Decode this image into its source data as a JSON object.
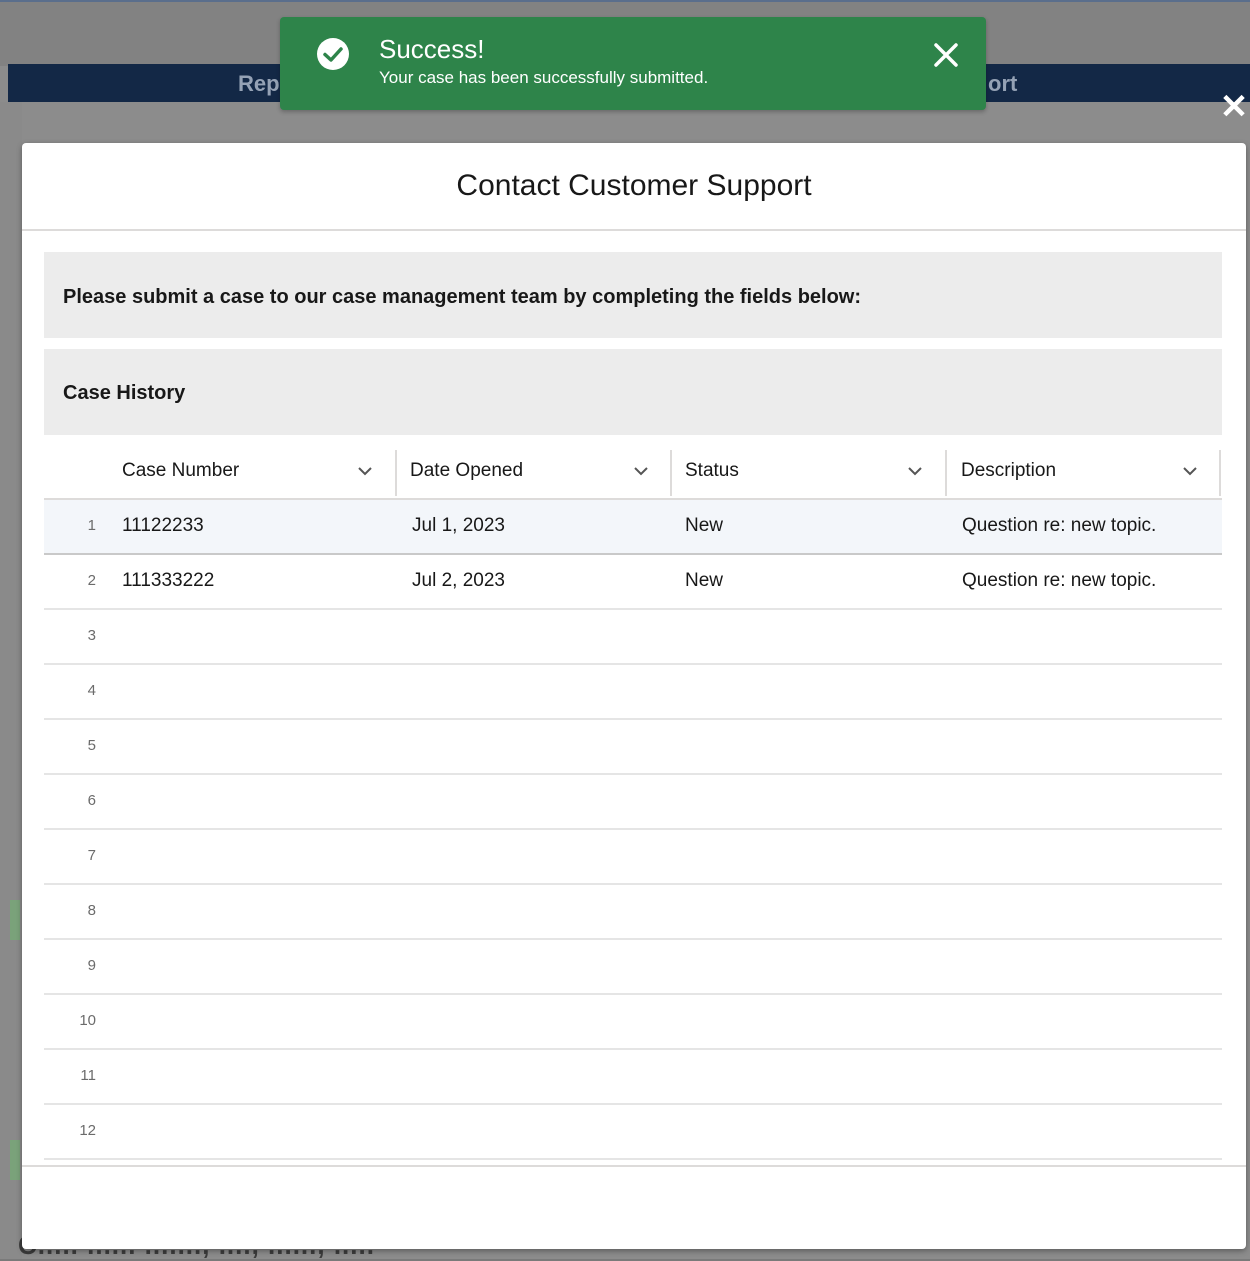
{
  "background": {
    "navbar_left_fragment": "Rep",
    "navbar_right_fragment": "ort",
    "footer_fragment": "C..... ...... ......., ...., ......, ....."
  },
  "toast": {
    "title": "Success!",
    "message": "Your case has been successfully submitted.",
    "icon": "success-check-icon",
    "close_icon": "close-icon",
    "color": "#2e844a"
  },
  "modal": {
    "title": "Contact Customer Support",
    "instruction": "Please submit a case to our case management team by completing the fields below:",
    "case_history_title": "Case History"
  },
  "table": {
    "columns": [
      "Case Number",
      "Date Opened",
      "Status",
      "Description"
    ],
    "rows": [
      {
        "num": "1",
        "case_number": "11122233",
        "date_opened": "Jul 1, 2023",
        "status": "New",
        "description": "Question re: new topic."
      },
      {
        "num": "2",
        "case_number": "111333222",
        "date_opened": "Jul 2, 2023",
        "status": "New",
        "description": "Question re: new topic."
      },
      {
        "num": "3",
        "case_number": "",
        "date_opened": "",
        "status": "",
        "description": ""
      },
      {
        "num": "4",
        "case_number": "",
        "date_opened": "",
        "status": "",
        "description": ""
      },
      {
        "num": "5",
        "case_number": "",
        "date_opened": "",
        "status": "",
        "description": ""
      },
      {
        "num": "6",
        "case_number": "",
        "date_opened": "",
        "status": "",
        "description": ""
      },
      {
        "num": "7",
        "case_number": "",
        "date_opened": "",
        "status": "",
        "description": ""
      },
      {
        "num": "8",
        "case_number": "",
        "date_opened": "",
        "status": "",
        "description": ""
      },
      {
        "num": "9",
        "case_number": "",
        "date_opened": "",
        "status": "",
        "description": ""
      },
      {
        "num": "10",
        "case_number": "",
        "date_opened": "",
        "status": "",
        "description": ""
      },
      {
        "num": "11",
        "case_number": "",
        "date_opened": "",
        "status": "",
        "description": ""
      },
      {
        "num": "12",
        "case_number": "",
        "date_opened": "",
        "status": "",
        "description": ""
      }
    ]
  }
}
